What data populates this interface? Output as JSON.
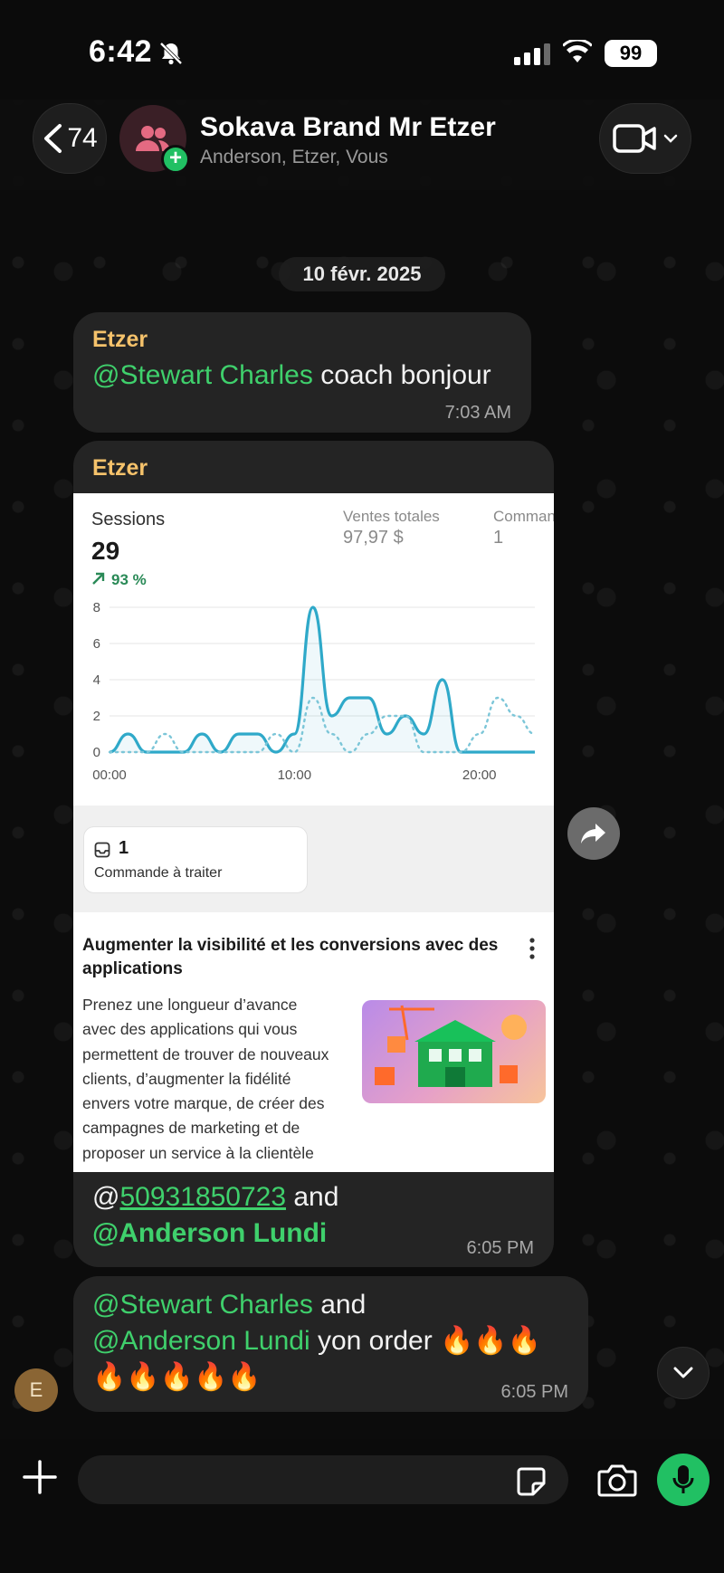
{
  "status_bar": {
    "time": "6:42",
    "battery": "99"
  },
  "header": {
    "back_count": "74",
    "title": "Sokava Brand Mr Etzer",
    "subtitle": "Anderson, Etzer, Vous"
  },
  "date_separator": "10 févr. 2025",
  "messages": [
    {
      "sender": "Etzer",
      "mention": "@Stewart Charles",
      "text": " coach bonjour",
      "time": "7:03 AM"
    },
    {
      "sender": "Etzer",
      "caption_at": "@",
      "caption_number": "50931850723",
      "caption_and": " and",
      "caption_mention": "@Anderson Lundi",
      "time": "6:05 PM"
    },
    {
      "mention1": "@Stewart Charles",
      "and": " and",
      "mention2": "@Anderson Lundi",
      "text": " yon order 🔥🔥🔥",
      "line3": "🔥🔥🔥🔥🔥",
      "time": "6:05 PM"
    }
  ],
  "embedded_screenshot": {
    "sessions_label": "Sessions",
    "sessions_value": "29",
    "sessions_change": "93 %",
    "sales_label": "Ventes totales",
    "sales_value": "97,97 $",
    "orders_label": "Comman",
    "orders_value": "1",
    "order_card_count": "1",
    "order_card_label": "Commande à traiter",
    "promo_title": "Augmenter la visibilité et les conversions avec des applications",
    "promo_body": "Prenez une longueur d’avance avec des applications qui vous permettent de trouver de nouveaux clients, d’augmenter la fidélité envers votre marque, de créer des campagnes de marketing et de proposer un service à la clientèle",
    "accent_color": "#2fa9c9"
  },
  "chart_data": {
    "type": "line",
    "x": [
      "00:00",
      "01:00",
      "02:00",
      "03:00",
      "04:00",
      "05:00",
      "06:00",
      "07:00",
      "08:00",
      "09:00",
      "10:00",
      "11:00",
      "12:00",
      "13:00",
      "14:00",
      "15:00",
      "16:00",
      "17:00",
      "18:00",
      "19:00",
      "20:00",
      "21:00",
      "22:00",
      "23:00"
    ],
    "series": [
      {
        "values": [
          0,
          1,
          0,
          0,
          0,
          1,
          0,
          1,
          1,
          0,
          1,
          8,
          2,
          3,
          3,
          1,
          2,
          1,
          4,
          0,
          0,
          0,
          0,
          0
        ],
        "style": "solid"
      },
      {
        "values": [
          0,
          0,
          0,
          1,
          0,
          0,
          0,
          0,
          0,
          1,
          0,
          3,
          1,
          0,
          1,
          2,
          2,
          0,
          0,
          0,
          1,
          3,
          2,
          1
        ],
        "style": "dotted"
      }
    ],
    "xticks": [
      "00:00",
      "10:00",
      "20:00"
    ],
    "yticks": [
      "0",
      "2",
      "4",
      "6",
      "8"
    ],
    "ylim": [
      0,
      8
    ],
    "grid": true
  },
  "input_bar": {
    "placeholder": ""
  },
  "avatar_letter": "E",
  "colors": {
    "mention": "#3fd06c",
    "sender": "#f5c26b",
    "bubble": "#242424",
    "send_green": "#21c063"
  }
}
